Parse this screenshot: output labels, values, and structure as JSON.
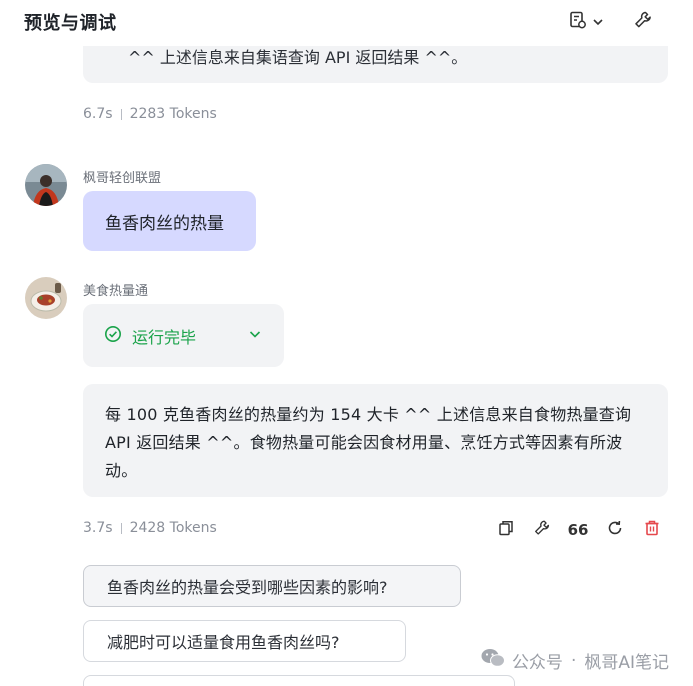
{
  "header": {
    "title": "预览与调试",
    "doc_icon": "document-settings-icon",
    "chevron_icon": "chevron-down-icon",
    "wrench_icon": "wrench-icon"
  },
  "messages": {
    "prev_bot_tail": "^^ 上述信息来自集语查询 API 返回结果 ^^。",
    "prev_meta": {
      "time": "6.7s",
      "tokens": "2283 Tokens"
    },
    "user": {
      "name": "枫哥轻创联盟",
      "text": "鱼香肉丝的热量"
    },
    "bot": {
      "name": "美食热量通",
      "status": "运行完毕",
      "answer": "每 100 克鱼香肉丝的热量约为 154 大卡 ^^ 上述信息来自食物热量查询 API 返回结果 ^^。食物热量可能会因食材用量、烹饪方式等因素有所波动。",
      "meta": {
        "time": "3.7s",
        "tokens": "2428 Tokens"
      },
      "quote_label": "66"
    }
  },
  "suggestions": [
    "鱼香肉丝的热量会受到哪些因素的影响?",
    "减肥时可以适量食用鱼香肉丝吗?"
  ],
  "watermark": {
    "left": "公众号",
    "dot": "·",
    "right": "枫哥AI笔记"
  },
  "colors": {
    "user_bubble": "#d6d9ff",
    "bot_bubble": "#f2f3f5",
    "success": "#1aa34a",
    "delete": "#e5484d"
  }
}
